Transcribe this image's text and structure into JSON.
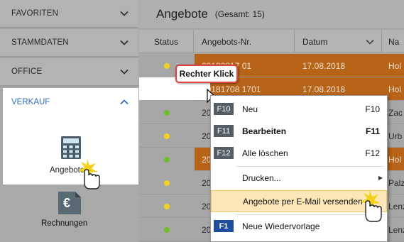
{
  "sidebar": {
    "sections": [
      {
        "label": "FAVORITEN"
      },
      {
        "label": "STAMMDATEN"
      },
      {
        "label": "OFFICE"
      }
    ],
    "verkauf": {
      "label": "VERKAUF",
      "items": [
        {
          "label": "Angebote",
          "icon": "calculator-icon"
        },
        {
          "label": "Rechnungen",
          "icon": "euro-document-icon"
        }
      ]
    }
  },
  "main": {
    "title": "Angebote",
    "count_text": "(Gesamt: 15)",
    "columns": [
      "Status",
      "Angebots-Nr.",
      "Datum",
      "Na"
    ],
    "rows": [
      {
        "status_color": "#f3d21b",
        "number": "20180817 01",
        "date": "17.08.2018",
        "name": "Hol",
        "highlight": "orange"
      },
      {
        "status_color": "#f3d21b",
        "number": "20181708 1701",
        "date": "17.08.2018",
        "name": "Hol",
        "highlight": "orange"
      },
      {
        "status_color": "#6fbf2a",
        "number": "20",
        "date": "",
        "name": "Zac",
        "highlight": "none"
      },
      {
        "status_color": "#f3d21b",
        "number": "20",
        "date": "",
        "name": "Urb",
        "highlight": "none"
      },
      {
        "status_color": "#6fbf2a",
        "number": "20",
        "date": "",
        "name": "Hol",
        "highlight": "orange"
      },
      {
        "status_color": "#f3d21b",
        "number": "20",
        "date": "",
        "name": "Palz",
        "highlight": "none"
      },
      {
        "status_color": "#f3d21b",
        "number": "20",
        "date": "",
        "name": "Lenz",
        "highlight": "none"
      },
      {
        "status_color": "#6fbf2a",
        "number": "20",
        "date": "",
        "name": "Lenz",
        "highlight": "none"
      }
    ]
  },
  "callout": {
    "text": "Rechter Klick"
  },
  "context_menu": {
    "items": [
      {
        "key": "F10",
        "label": "Neu",
        "shortcut": "F10"
      },
      {
        "key": "F11",
        "label": "Bearbeiten",
        "shortcut": "F11"
      },
      {
        "key": "F12",
        "label": "Alle löschen",
        "shortcut": "F12"
      },
      {
        "label": "Drucken..."
      },
      {
        "label": "Angebote per E-Mail versenden"
      },
      {
        "key": "F1",
        "label": "Neue Wiedervorlage"
      }
    ]
  },
  "colors": {
    "accent_orange": "#e8791c",
    "menu_highlight": "#fde7b8",
    "verkauf_blue": "#2f6db5",
    "callout_border": "#e04141"
  }
}
